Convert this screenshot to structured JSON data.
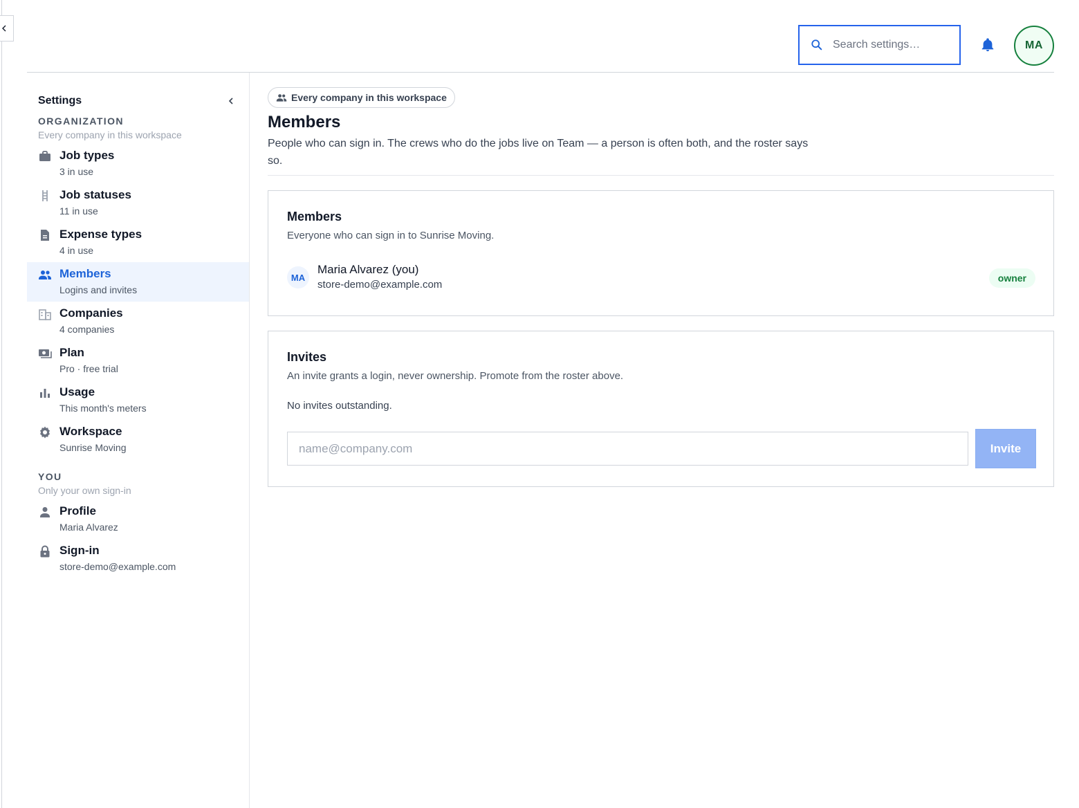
{
  "header": {
    "search_placeholder": "Search settings…",
    "avatar_initials": "MA"
  },
  "sidebar": {
    "title": "Settings",
    "sections": [
      {
        "heading": "ORGANIZATION",
        "subheading": "Every company in this workspace",
        "items": [
          {
            "label": "Job types",
            "sub": "3 in use",
            "icon": "briefcase-icon"
          },
          {
            "label": "Job statuses",
            "sub": "11 in use",
            "icon": "ladder-icon"
          },
          {
            "label": "Expense types",
            "sub": "4 in use",
            "icon": "document-icon"
          },
          {
            "label": "Members",
            "sub": "Logins and invites",
            "icon": "people-icon",
            "active": true
          },
          {
            "label": "Companies",
            "sub": "4 companies",
            "icon": "building-icon"
          },
          {
            "label": "Plan",
            "sub": "Pro · free trial",
            "icon": "money-icon"
          },
          {
            "label": "Usage",
            "sub": "This month's meters",
            "icon": "bar-chart-icon"
          },
          {
            "label": "Workspace",
            "sub": "Sunrise Moving",
            "icon": "gear-icon"
          }
        ]
      },
      {
        "heading": "YOU",
        "subheading": "Only your own sign-in",
        "items": [
          {
            "label": "Profile",
            "sub": "Maria Alvarez",
            "icon": "person-icon"
          },
          {
            "label": "Sign-in",
            "sub": "store-demo@example.com",
            "icon": "lock-icon"
          }
        ]
      }
    ]
  },
  "main": {
    "scope_pill": "Every company in this workspace",
    "title": "Members",
    "description": "People who can sign in. The crews who do the jobs live on Team — a person is often both, and the roster says so.",
    "members_card": {
      "title": "Members",
      "subtitle": "Everyone who can sign in to Sunrise Moving.",
      "members": [
        {
          "initials": "MA",
          "name": "Maria Alvarez (you)",
          "email": "store-demo@example.com",
          "role": "owner"
        }
      ]
    },
    "invites_card": {
      "title": "Invites",
      "subtitle": "An invite grants a login, never ownership. Promote from the roster above.",
      "empty_text": "No invites outstanding.",
      "input_placeholder": "name@company.com",
      "input_value": "",
      "button_label": "Invite"
    }
  },
  "colors": {
    "accent": "#1d63d8",
    "active_bg": "#eef4fe",
    "owner_badge_bg": "#ecfdf3",
    "owner_badge_text": "#15803d",
    "invite_button_disabled": "#93b4f5"
  }
}
